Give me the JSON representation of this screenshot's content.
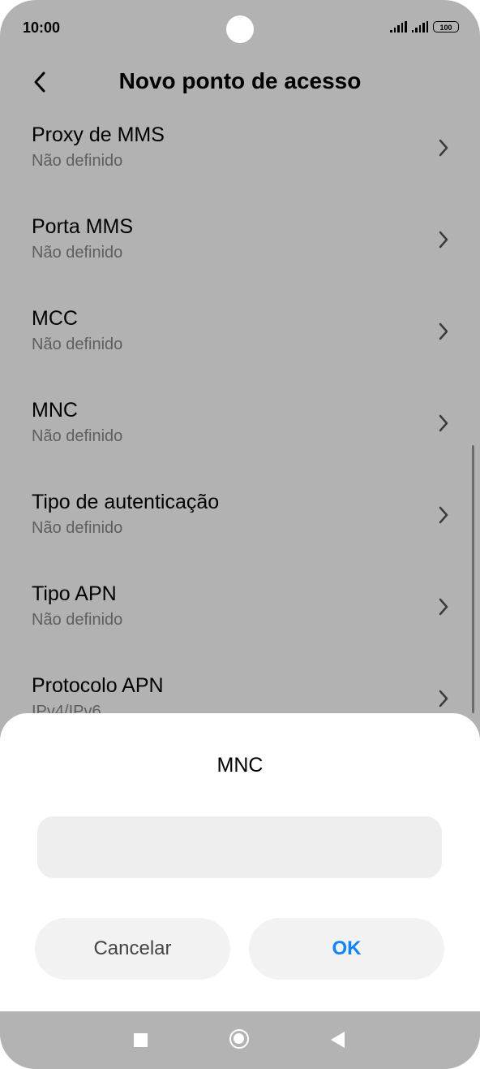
{
  "status_bar": {
    "time": "10:00",
    "battery": "100"
  },
  "app_bar": {
    "title": "Novo ponto de acesso"
  },
  "settings": [
    {
      "title": "Proxy de MMS",
      "value": "Não definido"
    },
    {
      "title": "Porta MMS",
      "value": "Não definido"
    },
    {
      "title": "MCC",
      "value": "Não definido"
    },
    {
      "title": "MNC",
      "value": "Não definido"
    },
    {
      "title": "Tipo de autenticação",
      "value": "Não definido"
    },
    {
      "title": "Tipo APN",
      "value": "Não definido"
    },
    {
      "title": "Protocolo APN",
      "value": "IPv4/IPv6"
    }
  ],
  "dialog": {
    "title": "MNC",
    "input_value": "",
    "cancel_label": "Cancelar",
    "ok_label": "OK"
  },
  "colors": {
    "accent": "#0d84ff",
    "dim_overlay": "rgba(0,0,0,0.30)"
  }
}
